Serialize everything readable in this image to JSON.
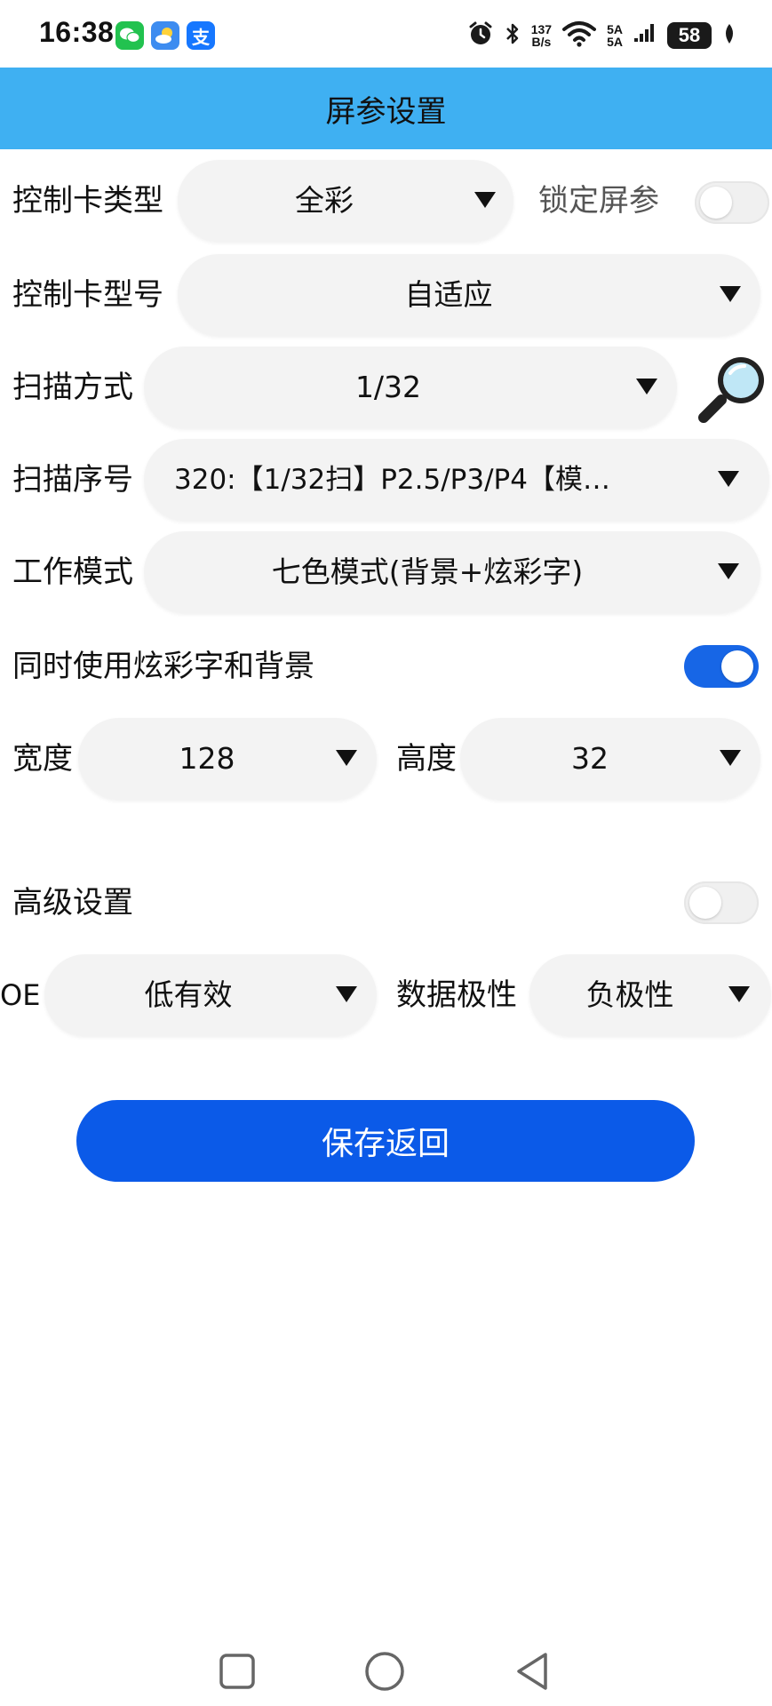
{
  "status": {
    "time": "16:38",
    "net_speed_value": "137",
    "net_speed_unit": "B/s",
    "signal_top": "5A",
    "signal_bottom": "5A",
    "battery": "58",
    "icons": [
      "wechat-icon",
      "weather-icon",
      "alipay-icon",
      "alarm-icon",
      "bluetooth-icon",
      "wifi-icon",
      "signal-icon",
      "battery-icon",
      "leaf-icon"
    ],
    "alipay_glyph": "支"
  },
  "header": {
    "title": "屏参设置"
  },
  "form": {
    "card_type": {
      "label": "控制卡类型",
      "value": "全彩"
    },
    "lock": {
      "label": "锁定屏参",
      "enabled": false
    },
    "card_model": {
      "label": "控制卡型号",
      "value": "自适应"
    },
    "scan_mode": {
      "label": "扫描方式",
      "value": "1/32"
    },
    "scan_index": {
      "label": "扫描序号",
      "value": "320:【1/32扫】P2.5/P3/P4【模…"
    },
    "work_mode": {
      "label": "工作模式",
      "value": "七色模式(背景+炫彩字)"
    },
    "combo": {
      "label": "同时使用炫彩字和背景",
      "enabled": true
    },
    "width": {
      "label": "宽度",
      "value": "128"
    },
    "height": {
      "label": "高度",
      "value": "32"
    },
    "advanced": {
      "label": "高级设置",
      "enabled": false
    },
    "oe": {
      "label": "OE",
      "value": "低有效"
    },
    "polarity": {
      "label": "数据极性",
      "value": "负极性"
    }
  },
  "actions": {
    "save_label": "保存返回"
  },
  "colors": {
    "header": "#3fb0f2",
    "primary": "#0b5ae8",
    "toggle_on": "#1766e6",
    "pill_bg": "#f3f3f3",
    "wechat": "#22c24f",
    "weather": "#3d8cf0",
    "alipay": "#1677ff"
  }
}
